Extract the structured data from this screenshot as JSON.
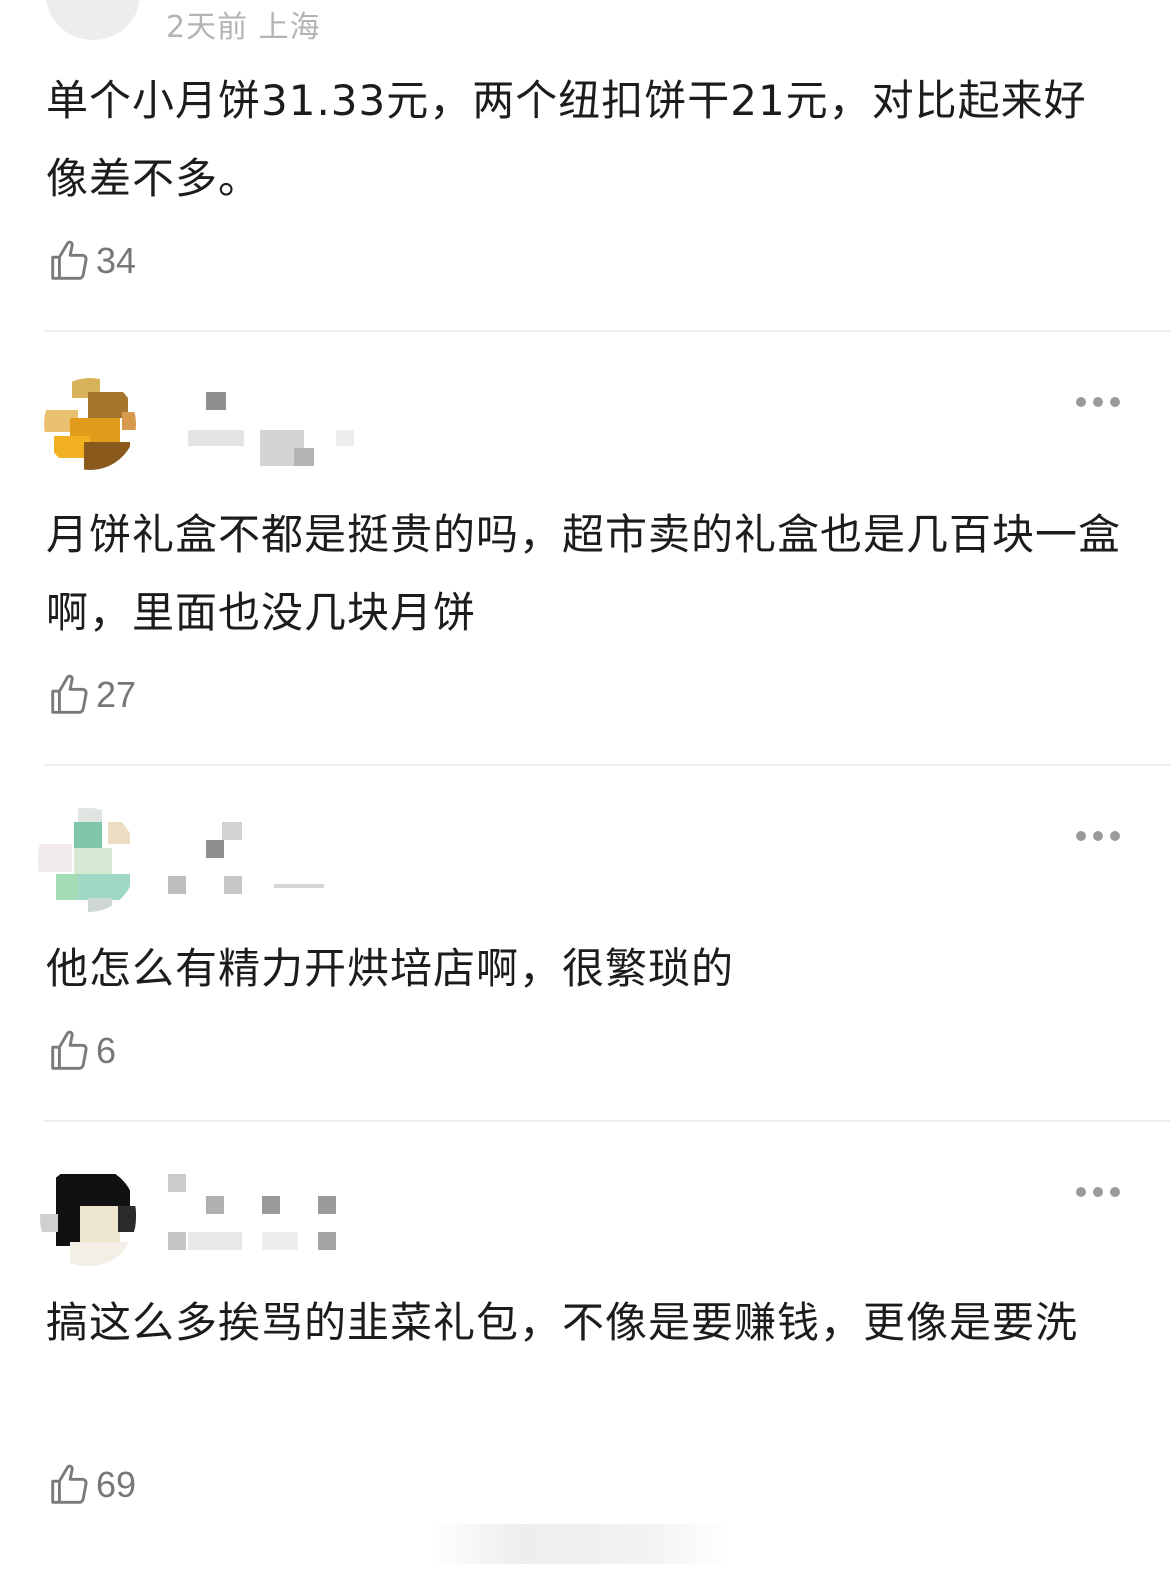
{
  "comments": [
    {
      "meta": "2天前 上海",
      "text": "单个小月饼31.33元，两个纽扣饼干21元，对比起来好像差不多。",
      "likes": "34"
    },
    {
      "text": "月饼礼盒不都是挺贵的吗，超市卖的礼盒也是几百块一盒啊，里面也没几块月饼",
      "likes": "27"
    },
    {
      "text": "他怎么有精力开烘培店啊，很繁琐的",
      "likes": "6"
    },
    {
      "text": "搞这么多挨骂的韭菜礼包，不像是要赚钱，更像是要洗",
      "likes": "69"
    }
  ],
  "icons": {
    "like": "thumbs-up-icon",
    "more": "more-dots-icon"
  },
  "colors": {
    "text": "#1c1c1c",
    "meta": "#b4b4b4",
    "like_count": "#777777",
    "divider": "#ececec"
  }
}
